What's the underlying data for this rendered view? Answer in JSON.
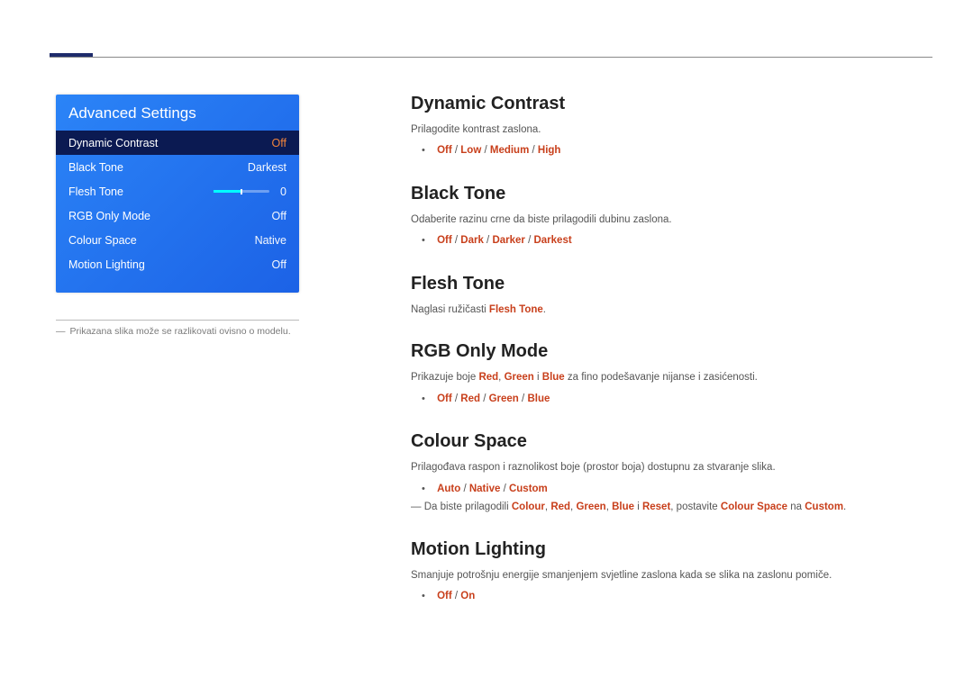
{
  "panel": {
    "title": "Advanced Settings",
    "items": [
      {
        "name": "Dynamic Contrast",
        "value": "Off",
        "selected": true
      },
      {
        "name": "Black Tone",
        "value": "Darkest"
      },
      {
        "name": "Flesh Tone",
        "value": "0",
        "slider": true
      },
      {
        "name": "RGB Only Mode",
        "value": "Off"
      },
      {
        "name": "Colour Space",
        "value": "Native"
      },
      {
        "name": "Motion Lighting",
        "value": "Off"
      }
    ]
  },
  "footnote_dash": "―",
  "footnote_text": "Prikazana slika može se razlikovati ovisno o modelu.",
  "sections": {
    "dynamic_contrast": {
      "title": "Dynamic Contrast",
      "desc": "Prilagodite kontrast zaslona.",
      "opts": [
        "Off",
        "Low",
        "Medium",
        "High"
      ]
    },
    "black_tone": {
      "title": "Black Tone",
      "desc": "Odaberite razinu crne da biste prilagodili dubinu zaslona.",
      "opts": [
        "Off",
        "Dark",
        "Darker",
        "Darkest"
      ]
    },
    "flesh_tone": {
      "title": "Flesh Tone",
      "desc_pre": "Naglasi ružičasti ",
      "desc_bold": "Flesh Tone",
      "desc_post": "."
    },
    "rgb_only": {
      "title": "RGB Only Mode",
      "desc_pre": "Prikazuje boje ",
      "desc_r": "Red",
      "desc_c1": ", ",
      "desc_g": "Green",
      "desc_c2": " i ",
      "desc_b": "Blue",
      "desc_post": " za fino podešavanje nijanse i zasićenosti.",
      "opts": [
        "Off",
        "Red",
        "Green",
        "Blue"
      ]
    },
    "colour_space": {
      "title": "Colour Space",
      "desc": "Prilagođava raspon i raznolikost boje (prostor boja) dostupnu za stvaranje slika.",
      "opts": [
        "Auto",
        "Native",
        "Custom"
      ],
      "subnote_dash": "―",
      "sub_pre": " Da biste prilagodili ",
      "sub_w": [
        "Colour",
        "Red",
        "Green",
        "Blue"
      ],
      "sub_sepA": ", ",
      "sub_and": " i ",
      "sub_reset": "Reset",
      "sub_mid": ", postavite ",
      "sub_cs": "Colour Space",
      "sub_na": " na ",
      "sub_custom": "Custom",
      "sub_end": "."
    },
    "motion_lighting": {
      "title": "Motion Lighting",
      "desc": "Smanjuje potrošnju energije smanjenjem svjetline zaslona kada se slika na zaslonu pomiče.",
      "opts": [
        "Off",
        "On"
      ]
    }
  },
  "sep": " / "
}
